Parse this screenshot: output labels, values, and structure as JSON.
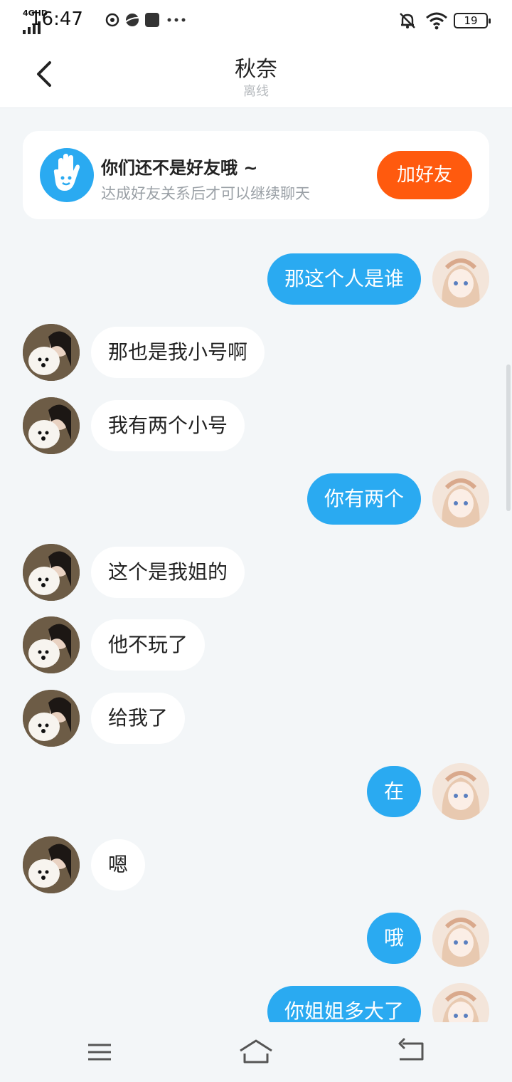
{
  "status_bar": {
    "network": "4GHD",
    "time": "16:47",
    "battery": "19",
    "icons": [
      "signal-icon",
      "cast-icon",
      "planet-icon",
      "square-icon",
      "more-dots-icon",
      "dnd-bell-icon",
      "wifi-icon",
      "battery-icon"
    ]
  },
  "header": {
    "title": "秋奈",
    "subtitle": "离线",
    "back_icon": "chevron-left-icon"
  },
  "notice": {
    "title": "你们还不是好友哦 ~",
    "subtitle": "达成好友关系后才可以继续聊天",
    "button": "加好友",
    "icon": "hand-wave-icon",
    "accent": "#ff5a0e"
  },
  "messages": [
    {
      "side": "right",
      "text": "那这个人是谁"
    },
    {
      "side": "left",
      "text": "那也是我小号啊"
    },
    {
      "side": "left",
      "text": "我有两个小号"
    },
    {
      "side": "right",
      "text": "你有两个"
    },
    {
      "side": "left",
      "text": "这个是我姐的"
    },
    {
      "side": "left",
      "text": "他不玩了"
    },
    {
      "side": "left",
      "text": "给我了"
    },
    {
      "side": "right",
      "text": "在"
    },
    {
      "side": "left",
      "text": "嗯"
    },
    {
      "side": "right",
      "text": "哦"
    },
    {
      "side": "right",
      "text": "你姐姐多大了"
    }
  ],
  "colors": {
    "bubble_self": "#2aaaf1",
    "bubble_other": "#ffffff",
    "background": "#f3f6f8"
  },
  "nav": {
    "icons": [
      "menu-icon",
      "home-icon",
      "back-icon"
    ]
  }
}
